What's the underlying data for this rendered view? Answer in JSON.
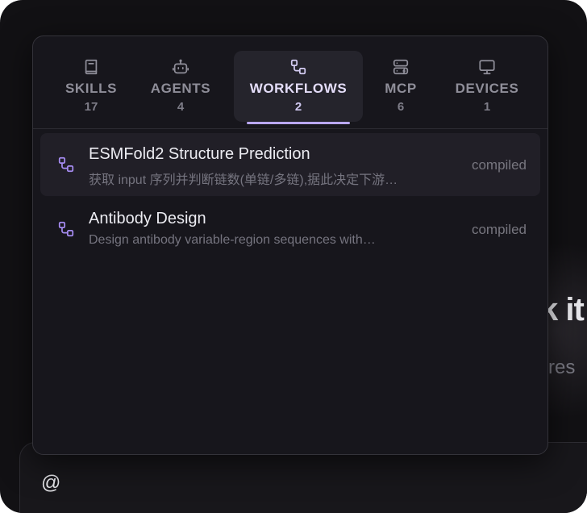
{
  "background": {
    "heading_fragment": "k it",
    "subtext_fragment": "l res"
  },
  "composer": {
    "value": "@"
  },
  "tabs": [
    {
      "label": "SKILLS",
      "count": "17",
      "icon": "book-icon",
      "active": false
    },
    {
      "label": "AGENTS",
      "count": "4",
      "icon": "robot-icon",
      "active": false
    },
    {
      "label": "WORKFLOWS",
      "count": "2",
      "icon": "workflow-icon",
      "active": true
    },
    {
      "label": "MCP",
      "count": "6",
      "icon": "server-icon",
      "active": false
    },
    {
      "label": "DEVICES",
      "count": "1",
      "icon": "monitor-icon",
      "active": false
    }
  ],
  "workflows": [
    {
      "title": "ESMFold2 Structure Prediction",
      "description": "获取 input 序列并判断链数(单链/多链),据此决定下游…",
      "status": "compiled",
      "icon": "workflow-icon"
    },
    {
      "title": "Antibody Design",
      "description": "Design antibody variable-region sequences with…",
      "status": "compiled",
      "icon": "workflow-icon"
    }
  ],
  "colors": {
    "accent": "#b9a7f5",
    "workflow_icon": "#a58bf0",
    "panel_bg": "#17161c",
    "window_bg": "#121114"
  }
}
